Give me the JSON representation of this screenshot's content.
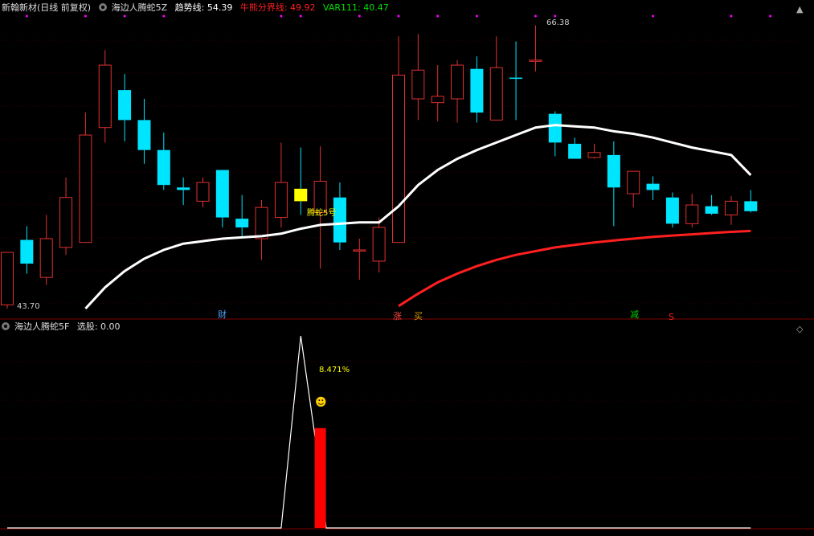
{
  "header": {
    "stock_name": "新翰新材",
    "period": "(日线 前复权)",
    "indicator_main": "海边人腾蛇5Z",
    "trend_label": "趋势线: 54.39",
    "bull_bear_label": "牛熊分界线: 49.92",
    "var_label": "VAR111: 40.47"
  },
  "sub_header": {
    "indicator_sub": "海边人腾蛇5F",
    "select_label": "选股: 0.00"
  },
  "controls": {
    "up_icon": "caret-up-icon",
    "diamond_icon": "diamond-icon"
  },
  "annotations": {
    "high_price": "66.38",
    "low_price": "43.70",
    "signal_label": "腾蛇5号",
    "cai": "财",
    "zhang": "涨",
    "mai": "买",
    "jian": "减",
    "s_mark": "S",
    "pct": "8.471%",
    "smiley": "☻"
  },
  "colors": {
    "up": "#e03030",
    "down": "#00e5ff",
    "trend": "#ffffff",
    "bull_bear": "#ff1f1f",
    "var": "#00cc00",
    "signal_box": "#ffff00",
    "bar": "#ff0000"
  },
  "chart_data": {
    "type": "candlestick",
    "candles": [
      {
        "o": 44.0,
        "h": 46.8,
        "l": 43.7,
        "c": 48.2
      },
      {
        "o": 49.2,
        "h": 50.3,
        "l": 46.5,
        "c": 47.3
      },
      {
        "o": 46.2,
        "h": 51.2,
        "l": 45.6,
        "c": 49.3
      },
      {
        "o": 48.6,
        "h": 54.2,
        "l": 48.0,
        "c": 52.6
      },
      {
        "o": 49.0,
        "h": 59.4,
        "l": 49.0,
        "c": 57.6
      },
      {
        "o": 58.2,
        "h": 64.4,
        "l": 57.0,
        "c": 63.2
      },
      {
        "o": 61.2,
        "h": 62.5,
        "l": 57.1,
        "c": 58.8
      },
      {
        "o": 58.8,
        "h": 60.5,
        "l": 55.3,
        "c": 56.4
      },
      {
        "o": 56.4,
        "h": 57.8,
        "l": 53.2,
        "c": 53.6
      },
      {
        "o": 53.4,
        "h": 54.2,
        "l": 52.0,
        "c": 53.2
      },
      {
        "o": 52.3,
        "h": 54.2,
        "l": 51.8,
        "c": 53.8
      },
      {
        "o": 54.8,
        "h": 54.8,
        "l": 50.2,
        "c": 51.0
      },
      {
        "o": 50.9,
        "h": 52.8,
        "l": 49.5,
        "c": 50.2
      },
      {
        "o": 49.3,
        "h": 52.4,
        "l": 47.6,
        "c": 51.8
      },
      {
        "o": 51.0,
        "h": 57.0,
        "l": 50.2,
        "c": 53.8
      },
      {
        "o": 53.3,
        "h": 56.6,
        "l": 51.2,
        "c": 52.3
      },
      {
        "o": 51.4,
        "h": 56.7,
        "l": 46.9,
        "c": 53.9
      },
      {
        "o": 52.6,
        "h": 53.8,
        "l": 48.4,
        "c": 49.0
      },
      {
        "o": 48.4,
        "h": 49.3,
        "l": 46.0,
        "c": 48.4
      },
      {
        "o": 47.5,
        "h": 51.0,
        "l": 46.6,
        "c": 50.2
      },
      {
        "o": 49.0,
        "h": 65.5,
        "l": 49.0,
        "c": 62.4
      },
      {
        "o": 60.5,
        "h": 65.7,
        "l": 58.8,
        "c": 62.8
      },
      {
        "o": 60.2,
        "h": 63.2,
        "l": 58.7,
        "c": 60.7
      },
      {
        "o": 60.5,
        "h": 63.6,
        "l": 58.6,
        "c": 63.2
      },
      {
        "o": 62.9,
        "h": 63.9,
        "l": 58.6,
        "c": 59.4
      },
      {
        "o": 58.8,
        "h": 65.5,
        "l": 58.8,
        "c": 63.0
      },
      {
        "o": 62.2,
        "h": 65.1,
        "l": 58.8,
        "c": 62.1
      },
      {
        "o": 63.6,
        "h": 66.38,
        "l": 62.7,
        "c": 63.6
      },
      {
        "o": 59.3,
        "h": 59.5,
        "l": 55.9,
        "c": 57.0
      },
      {
        "o": 56.9,
        "h": 57.4,
        "l": 55.7,
        "c": 55.7
      },
      {
        "o": 55.8,
        "h": 56.9,
        "l": 55.7,
        "c": 56.2
      },
      {
        "o": 56.0,
        "h": 57.1,
        "l": 50.3,
        "c": 53.4
      },
      {
        "o": 52.9,
        "h": 54.7,
        "l": 51.8,
        "c": 54.7
      },
      {
        "o": 53.7,
        "h": 54.3,
        "l": 52.4,
        "c": 53.2
      },
      {
        "o": 52.6,
        "h": 53.0,
        "l": 50.2,
        "c": 50.5
      },
      {
        "o": 50.5,
        "h": 52.9,
        "l": 50.2,
        "c": 52.0
      },
      {
        "o": 51.9,
        "h": 52.8,
        "l": 51.2,
        "c": 51.3
      },
      {
        "o": 51.2,
        "h": 52.7,
        "l": 50.4,
        "c": 52.3
      },
      {
        "o": 52.3,
        "h": 53.2,
        "l": 51.4,
        "c": 51.5
      }
    ],
    "trend_line": [
      null,
      null,
      null,
      null,
      43.7,
      45.4,
      46.7,
      47.7,
      48.4,
      48.9,
      49.1,
      49.3,
      49.4,
      49.5,
      49.7,
      50.1,
      50.4,
      50.5,
      50.6,
      50.6,
      51.9,
      53.6,
      54.8,
      55.7,
      56.4,
      57.0,
      57.6,
      58.2,
      58.4,
      58.3,
      58.2,
      57.9,
      57.7,
      57.4,
      57.0,
      56.6,
      56.3,
      56.0,
      54.39
    ],
    "bull_bear_line": [
      null,
      null,
      null,
      null,
      null,
      null,
      null,
      null,
      null,
      null,
      null,
      null,
      null,
      null,
      null,
      null,
      null,
      null,
      null,
      null,
      43.9,
      44.9,
      45.8,
      46.5,
      47.1,
      47.6,
      48.0,
      48.3,
      48.6,
      48.8,
      49.0,
      49.15,
      49.3,
      49.45,
      49.55,
      49.65,
      49.75,
      49.85,
      49.92
    ],
    "ylim": [
      43.7,
      67.0
    ],
    "sub_ylim": [
      0,
      100
    ],
    "sub_line": [
      {
        "i": 14,
        "v": 0
      },
      {
        "i": 15,
        "v": 100
      },
      {
        "i": 16,
        "v": 28
      },
      {
        "i": 16.3,
        "v": 0
      }
    ],
    "sub_bar": {
      "i": 16,
      "v": 52
    },
    "markers_top": [
      1,
      4,
      6,
      8,
      14,
      15,
      18,
      20,
      22,
      24,
      27,
      28,
      33,
      37,
      39
    ]
  }
}
